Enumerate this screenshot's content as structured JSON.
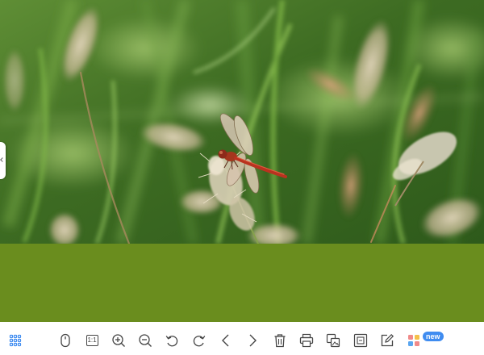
{
  "viewer": {
    "image_subject": "dragonfly-on-grass",
    "fill_color": "#6a8d1e",
    "accent_color": "#3f8cf0"
  },
  "toolbar": {
    "items": [
      {
        "icon": "grid-icon"
      },
      {
        "icon": "mouse-icon"
      },
      {
        "icon": "actual-size-icon",
        "label": "1:1"
      },
      {
        "icon": "zoom-in-icon"
      },
      {
        "icon": "zoom-out-icon"
      },
      {
        "icon": "rotate-left-icon"
      },
      {
        "icon": "rotate-right-icon"
      },
      {
        "icon": "previous-icon"
      },
      {
        "icon": "next-icon"
      },
      {
        "icon": "delete-icon"
      },
      {
        "icon": "print-icon"
      },
      {
        "icon": "copy-image-icon"
      },
      {
        "icon": "resize-icon"
      },
      {
        "icon": "edit-icon"
      },
      {
        "icon": "apps-icon"
      }
    ],
    "new_badge": "new"
  }
}
